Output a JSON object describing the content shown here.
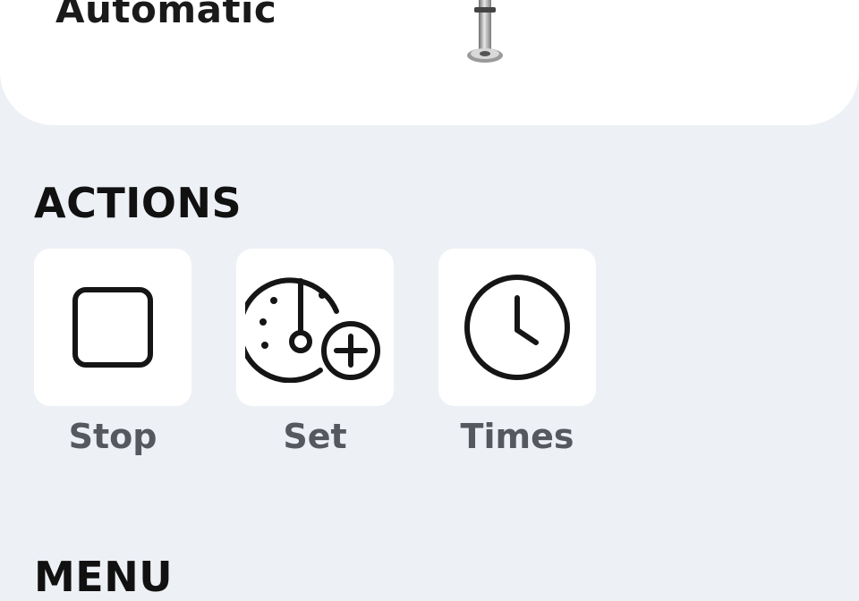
{
  "status_card": {
    "mode_value": "Automatic",
    "device_icon": "valve-stem-icon"
  },
  "actions": {
    "title": "ACTIONS",
    "items": [
      {
        "label": "Stop",
        "icon": "stop-square-icon"
      },
      {
        "label": "Set",
        "icon": "timer-add-icon"
      },
      {
        "label": "Times",
        "icon": "clock-icon"
      }
    ]
  },
  "menu": {
    "title": "MENU"
  },
  "colors": {
    "background": "#edf0f5",
    "card": "#ffffff",
    "label_gray": "#55595f",
    "text_dark": "#111111"
  }
}
